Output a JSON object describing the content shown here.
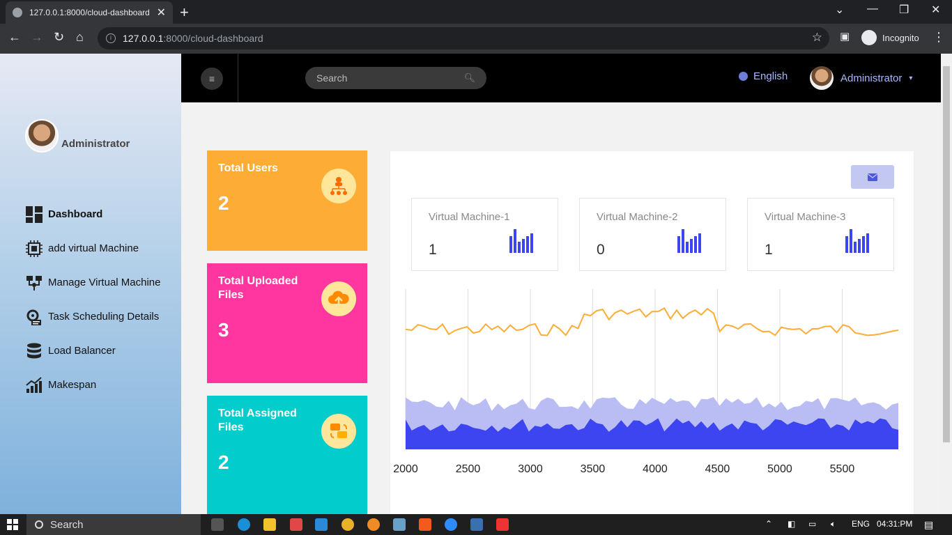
{
  "browser": {
    "tab_title": "127.0.0.1:8000/cloud-dashboard",
    "url_host": "127.0.0.1",
    "url_path": ":8000/cloud-dashboard",
    "profile_label": "Incognito"
  },
  "sidebar": {
    "user_name": "Administrator",
    "items": [
      {
        "label": "Dashboard",
        "icon": "dashboard-grid-icon",
        "active": true
      },
      {
        "label": "add virtual Machine",
        "icon": "cpu-chip-icon"
      },
      {
        "label": "Manage Virtual Machine",
        "icon": "network-nodes-icon"
      },
      {
        "label": "Task Scheduling Details",
        "icon": "task-gear-icon"
      },
      {
        "label": "Load Balancer",
        "icon": "database-icon"
      },
      {
        "label": "Makespan",
        "icon": "growth-chart-icon"
      }
    ]
  },
  "header": {
    "search_placeholder": "Search",
    "language": "English",
    "user_name": "Administrator"
  },
  "cards": [
    {
      "title": "Total Users",
      "value": "2",
      "color": "#fdac35",
      "icon": "users-hierarchy-icon"
    },
    {
      "title": "Total Uploaded Files",
      "value": "3",
      "color": "#ff36a0",
      "icon": "cloud-upload-icon"
    },
    {
      "title": "Total Assigned Files",
      "value": "2",
      "color": "#02cccc",
      "icon": "file-transfer-icon"
    }
  ],
  "vms": [
    {
      "title": "Virtual Machine-1",
      "value": "1"
    },
    {
      "title": "Virtual Machine-2",
      "value": "0"
    },
    {
      "title": "Virtual Machine-3",
      "value": "1"
    }
  ],
  "chart_data": {
    "type": "area",
    "x_ticks": [
      "2000",
      "2500",
      "3000",
      "3500",
      "4000",
      "4500",
      "5000",
      "5500"
    ],
    "xlim": [
      2000,
      5950
    ],
    "series": [
      {
        "color": "#fdac35",
        "style": "line",
        "level": "upper band, approx 72% of chart height with spike near 3500-4500"
      },
      {
        "color": "#b9bdf3",
        "style": "area",
        "level": "approx 30% of chart height"
      },
      {
        "color": "#3c45f0",
        "style": "area",
        "level": "approx 18% of chart height"
      }
    ],
    "grid": "vertical lines at ticks"
  },
  "taskbar": {
    "search_label": "Search",
    "lang": "ENG",
    "time": "04:31:PM"
  }
}
